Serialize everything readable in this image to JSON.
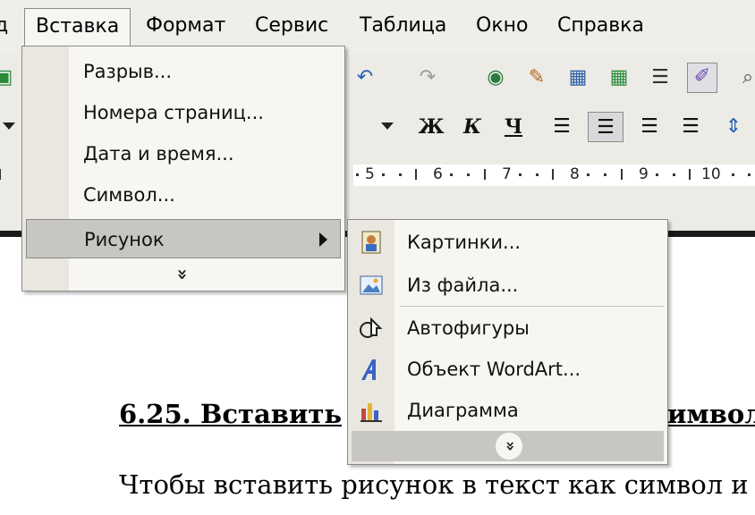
{
  "menubar": {
    "items": [
      {
        "label": "д",
        "name": "menu-view-partial"
      },
      {
        "label": "Вставка",
        "name": "menu-insert"
      },
      {
        "label": "Формат",
        "name": "menu-format"
      },
      {
        "label": "Сервис",
        "name": "menu-tools"
      },
      {
        "label": "Таблица",
        "name": "menu-table"
      },
      {
        "label": "Окно",
        "name": "menu-window"
      },
      {
        "label": "Справка",
        "name": "menu-help"
      }
    ]
  },
  "toolbar": {
    "bold_label": "Ж",
    "italic_label": "К",
    "underline_label": "Ч"
  },
  "ruler": {
    "numbers": [
      "5",
      "6",
      "7",
      "8",
      "9",
      "10"
    ]
  },
  "insert_menu": {
    "items": [
      "Разрыв...",
      "Номера страниц...",
      "Дата и время...",
      "Символ...",
      "Рисунок"
    ],
    "expand_icon": "double-chevron-down-icon"
  },
  "picture_submenu": {
    "items": [
      {
        "label": "Картинки...",
        "icon": "clipart-icon"
      },
      {
        "label": "Из файла...",
        "icon": "picture-from-file-icon"
      },
      {
        "label": "Автофигуры",
        "icon": "autoshapes-icon"
      },
      {
        "label": "Объект WordArt...",
        "icon": "wordart-icon"
      },
      {
        "label": "Диаграмма",
        "icon": "chart-icon"
      }
    ],
    "expand_icon": "double-chevron-down-icon"
  },
  "document": {
    "heading_left": "6.25. Вставить",
    "heading_right": "имвол",
    "body_text": "Чтобы вставить рисунок в текст как символ и"
  },
  "colors": {
    "menu_bg": "#f7f6f2",
    "highlight": "#c7c6c2",
    "toolbar_bg": "#ecebe5"
  }
}
